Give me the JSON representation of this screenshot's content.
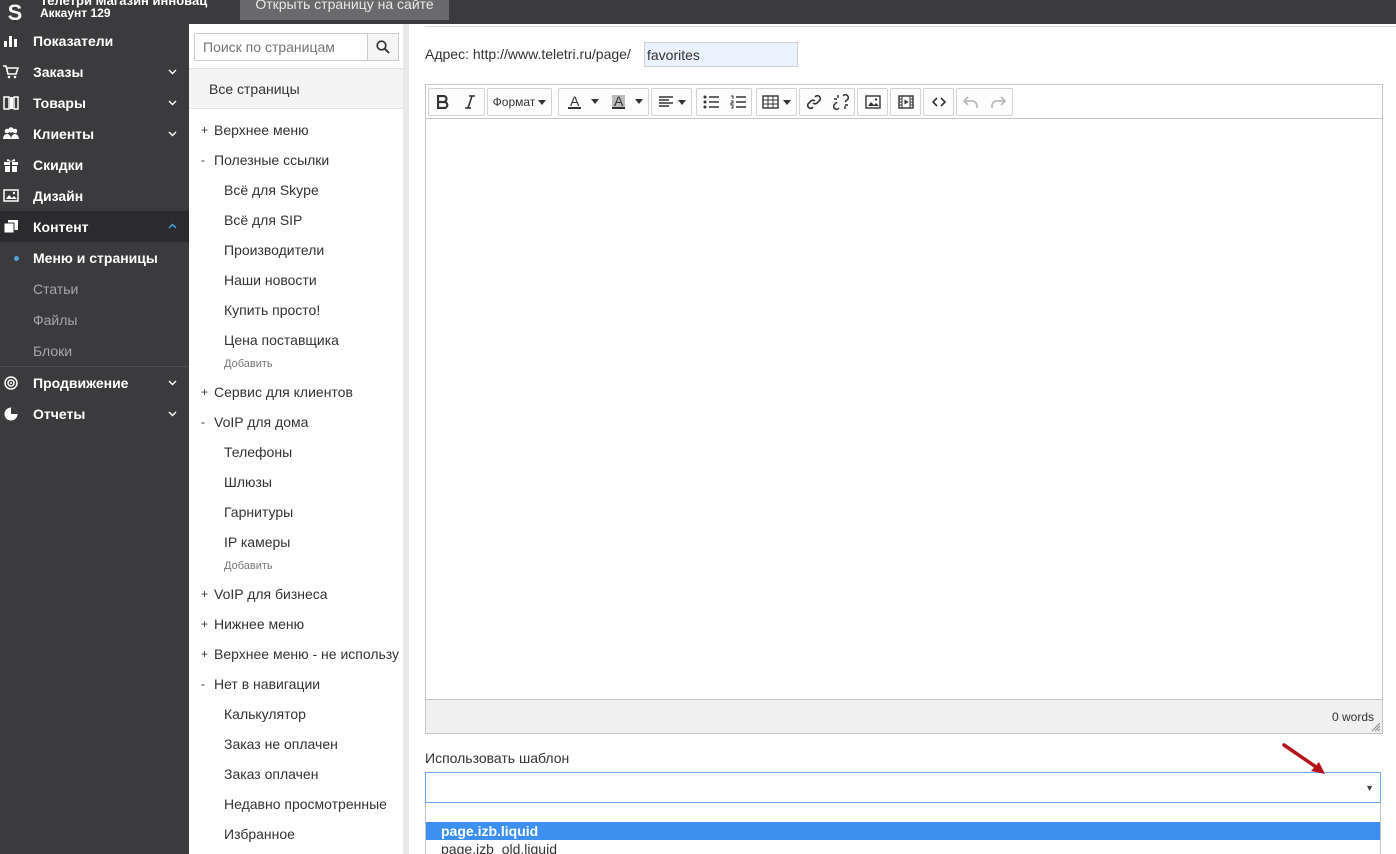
{
  "topbar": {
    "logo": "S",
    "account_name": "Телетри Магазин инновац",
    "account_sub": "Аккаунт 129",
    "open_site_label": "Открыть страницу на сайте"
  },
  "nav": {
    "items": [
      {
        "label": "Показатели",
        "icon": "bar-chart-icon"
      },
      {
        "label": "Заказы",
        "icon": "cart-icon"
      },
      {
        "label": "Товары",
        "icon": "box-icon"
      },
      {
        "label": "Клиенты",
        "icon": "users-icon"
      },
      {
        "label": "Скидки",
        "icon": "gift-icon"
      },
      {
        "label": "Дизайн",
        "icon": "image-icon"
      },
      {
        "label": "Контент",
        "icon": "pages-icon"
      },
      {
        "label": "Продвижение",
        "icon": "target-icon"
      },
      {
        "label": "Отчеты",
        "icon": "pie-chart-icon"
      }
    ],
    "content_sub": [
      "Меню и страницы",
      "Статьи",
      "Файлы",
      "Блоки"
    ]
  },
  "tree": {
    "search_placeholder": "Поиск по страницам",
    "all_pages": "Все страницы",
    "add_label": "Добавить",
    "rows": [
      {
        "toggle": "+",
        "label": "Верхнее меню"
      },
      {
        "toggle": "-",
        "label": "Полезные ссылки"
      },
      {
        "label": "Всё для Skype"
      },
      {
        "label": "Всё для SIP"
      },
      {
        "label": "Производители"
      },
      {
        "label": "Наши новости"
      },
      {
        "label": "Купить просто!"
      },
      {
        "label": "Цена поставщика"
      },
      {
        "toggle": "+",
        "label": "Сервис для клиентов"
      },
      {
        "toggle": "-",
        "label": "VoIP для дома"
      },
      {
        "label": "Телефоны"
      },
      {
        "label": "Шлюзы"
      },
      {
        "label": "Гарнитуры"
      },
      {
        "label": "IP камеры"
      },
      {
        "toggle": "+",
        "label": "VoIP для бизнеса"
      },
      {
        "toggle": "+",
        "label": "Нижнее меню"
      },
      {
        "toggle": "+",
        "label": "Верхнее меню - не использу"
      },
      {
        "toggle": "-",
        "label": "Нет в навигации"
      },
      {
        "label": "Калькулятор"
      },
      {
        "label": "Заказ не оплачен"
      },
      {
        "label": "Заказ оплачен"
      },
      {
        "label": "Недавно просмотренные"
      },
      {
        "label": "Избранное"
      }
    ]
  },
  "main": {
    "address_label": "Адрес:",
    "address_prefix": "http://www.teletri.ru/page/",
    "address_value": "favorites",
    "toolbar": {
      "format_label": "Формат"
    },
    "word_count": "0 words",
    "template_label": "Использовать шаблон",
    "template_value": "",
    "template_options": [
      "page.izb.liquid",
      "page.izb_old.liquid"
    ]
  },
  "colors": {
    "sidebar_bg": "#3b3b3d",
    "active_dot": "#4aa3df",
    "selected_option": "#3d8ff0",
    "annotation_arrow": "#b3141b"
  }
}
